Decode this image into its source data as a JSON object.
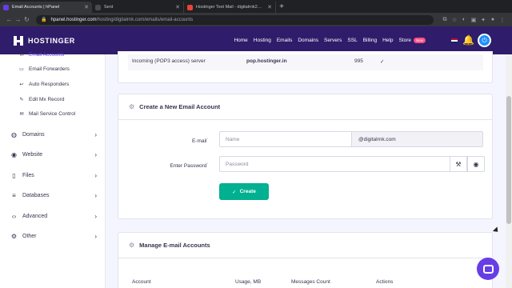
{
  "browser": {
    "tabs": [
      {
        "title": "Email Accounts | hPanel",
        "active": true,
        "favicon_color": "#673de6"
      },
      {
        "title": "Sent",
        "active": false,
        "favicon_color": "#3a3a3a"
      },
      {
        "title": "Hostinger Test Mail - digitalrnk2…",
        "active": false,
        "favicon_color": "#ea4335"
      }
    ],
    "new_tab": "+",
    "url_host": "hpanel.hostinger.com",
    "url_path": "/hosting/digitalrnk.com/emails/email-accounts"
  },
  "topnav": {
    "brand": "HOSTINGER",
    "items": [
      "Home",
      "Hosting",
      "Emails",
      "Domains",
      "Servers",
      "SSL",
      "Billing",
      "Help",
      "Store"
    ],
    "store_badge": "New"
  },
  "sidebar": {
    "sub_items": [
      {
        "label": "Email Accounts",
        "icon": "envelope-icon"
      },
      {
        "label": "Email Forwarders",
        "icon": "forward-icon"
      },
      {
        "label": "Auto Responders",
        "icon": "reply-icon"
      },
      {
        "label": "Edit Mx Record",
        "icon": "edit-icon"
      },
      {
        "label": "Mail Service Control",
        "icon": "mail-control-icon"
      }
    ],
    "sections": [
      {
        "label": "Domains",
        "icon": "globe-icon"
      },
      {
        "label": "Website",
        "icon": "website-icon"
      },
      {
        "label": "Files",
        "icon": "file-icon"
      },
      {
        "label": "Databases",
        "icon": "database-icon"
      },
      {
        "label": "Advanced",
        "icon": "code-icon"
      },
      {
        "label": "Other",
        "icon": "gear-icon"
      }
    ]
  },
  "info_row": {
    "name": "Incoming (POP3 access) server",
    "host": "pop.hostinger.in",
    "port": "995",
    "check": "✓"
  },
  "create_card": {
    "title": "Create a New Email Account",
    "email_label": "E-mail",
    "email_placeholder": "Name",
    "domain_suffix": "@digitalrnk.com",
    "password_label": "Enter Password",
    "password_placeholder": "Password",
    "button_label": "Create",
    "required_mark": "*"
  },
  "manage_card": {
    "title": "Manage E-mail Accounts",
    "columns": [
      "Account",
      "Usage, MB",
      "Messages Count",
      "Actions"
    ]
  },
  "colors": {
    "brand": "#673de6",
    "nav_bg": "#2f1c6a",
    "create_button": "#00b090"
  }
}
